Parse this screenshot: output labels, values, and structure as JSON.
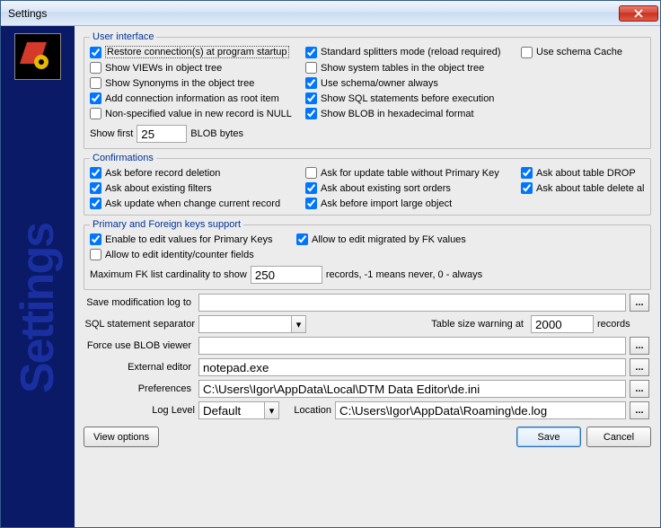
{
  "window": {
    "title": "Settings"
  },
  "sidebar": {
    "vertical_text": "Settings"
  },
  "groups": {
    "ui": {
      "legend": "User interface",
      "c_restore": "Restore connection(s) at program startup",
      "c_standard_splitters": "Standard splitters mode (reload required)",
      "c_use_schema_cache": "Use schema Cache",
      "c_show_views": "Show VIEWs in object tree",
      "c_show_system": "Show system tables in the object tree",
      "c_show_synonyms": "Show Synonyms in the object tree",
      "c_use_schema_owner": "Use schema/owner always",
      "c_add_conn_info": "Add connection information as root item",
      "c_show_sql_before": "Show SQL statements before execution",
      "c_nonspec_null": "Non-specified value in new record is NULL",
      "c_show_blob_hex": "Show BLOB in hexadecimal format",
      "show_first_label": "Show first",
      "show_first_value": "25",
      "blob_bytes_label": "BLOB bytes"
    },
    "confirm": {
      "legend": "Confirmations",
      "c_ask_delete": "Ask before record deletion",
      "c_ask_update_nopk": "Ask for update table without Primary Key",
      "c_ask_drop": "Ask about table DROP",
      "c_ask_filters": "Ask about existing filters",
      "c_ask_sort": "Ask about existing sort orders",
      "c_ask_delete_all": "Ask about table delete all",
      "c_ask_update_change": "Ask update when change current record",
      "c_ask_import_lob": "Ask before import large object"
    },
    "pkfk": {
      "legend": "Primary and Foreign keys support",
      "c_edit_pk": "Enable to edit values for Primary Keys",
      "c_allow_migrated": "Allow to edit migrated by FK values",
      "c_edit_identity": "Allow to edit identity/counter fields",
      "max_fk_label": "Maximum FK list cardinality to show",
      "max_fk_value": "250",
      "max_fk_suffix": "records, -1 means never, 0 - always"
    }
  },
  "fields": {
    "save_log": {
      "label": "Save modification log to",
      "value": ""
    },
    "sql_sep": {
      "label": "SQL statement separator",
      "value": ""
    },
    "table_warn": {
      "label": "Table size warning at",
      "value": "2000",
      "suffix": "records"
    },
    "force_blob": {
      "label": "Force use BLOB viewer",
      "value": ""
    },
    "ext_editor": {
      "label": "External editor",
      "value": "notepad.exe"
    },
    "prefs": {
      "label": "Preferences",
      "value": "C:\\Users\\Igor\\AppData\\Local\\DTM Data Editor\\de.ini"
    },
    "log_level": {
      "label": "Log Level",
      "value": "Default"
    },
    "location": {
      "label": "Location",
      "value": "C:\\Users\\Igor\\AppData\\Roaming\\de.log"
    }
  },
  "buttons": {
    "view_options": "View options",
    "save": "Save",
    "cancel": "Cancel",
    "browse": "..."
  }
}
